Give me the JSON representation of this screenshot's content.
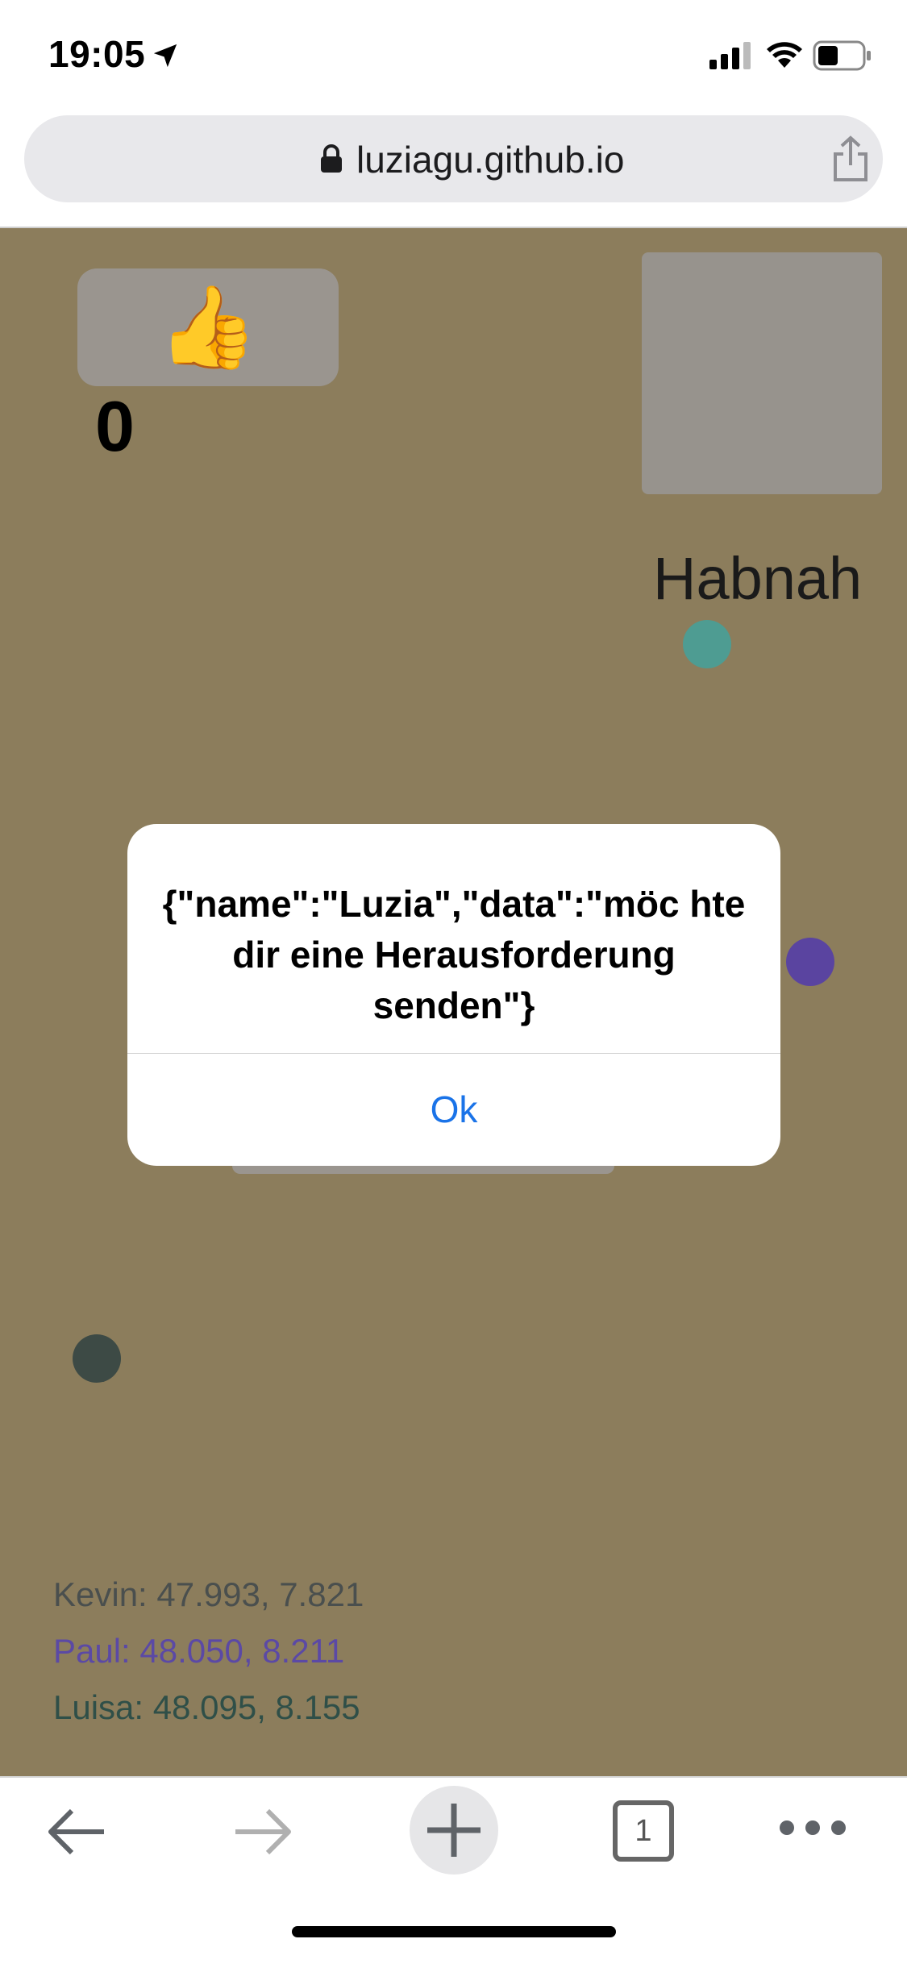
{
  "status_bar": {
    "time": "19:05"
  },
  "browser": {
    "url": "luziagu.github.io",
    "tab_count": "1"
  },
  "page": {
    "like_emoji": "👍",
    "like_count": "0",
    "player_name": "Habnah",
    "coordinates": [
      {
        "text": "Kevin: 47.993, 7.821",
        "color": "#4a4f4e"
      },
      {
        "text": "Paul: 48.050, 8.211",
        "color": "#5b49a5"
      },
      {
        "text": "Luisa: 48.095, 8.155",
        "color": "#2f4f48"
      }
    ]
  },
  "dialog": {
    "message": "{\"name\":\"Luzia\",\"data\":\"möc hte dir eine Herausforderung senden\"}",
    "ok_label": "Ok"
  },
  "colors": {
    "page_background": "#8c7d5c",
    "dialog_button": "#1a73e8"
  }
}
